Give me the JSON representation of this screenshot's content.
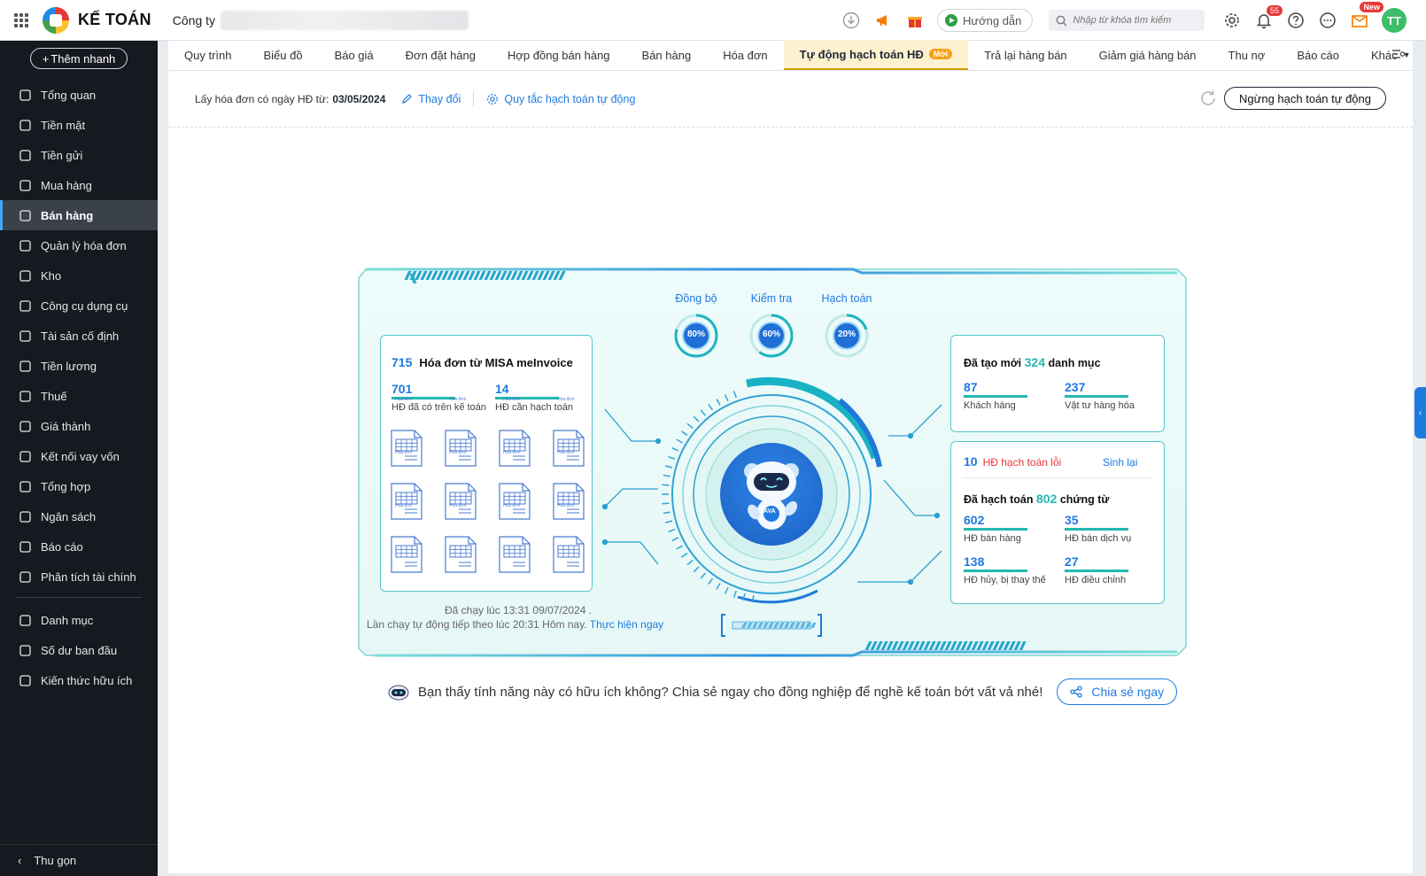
{
  "header": {
    "app_name": "KẾ TOÁN",
    "company_label": "Công ty",
    "guide_label": "Hướng dẫn",
    "search_placeholder": "Nhập từ khóa tìm kiếm",
    "notification_count": "55",
    "new_badge": "New",
    "avatar_initials": "TT"
  },
  "sidebar": {
    "quick_add": "Thêm nhanh",
    "items": [
      {
        "label": "Tổng quan",
        "icon": "chart-pie-icon"
      },
      {
        "label": "Tiền mặt",
        "icon": "money-bag-icon"
      },
      {
        "label": "Tiền gửi",
        "icon": "bank-icon"
      },
      {
        "label": "Mua hàng",
        "icon": "shopping-bag-icon"
      },
      {
        "label": "Bán hàng",
        "icon": "cart-icon",
        "active": true
      },
      {
        "label": "Quản lý hóa đơn",
        "icon": "invoice-icon"
      },
      {
        "label": "Kho",
        "icon": "warehouse-icon"
      },
      {
        "label": "Công cụ dụng cụ",
        "icon": "tools-icon"
      },
      {
        "label": "Tài sản cố định",
        "icon": "asset-icon"
      },
      {
        "label": "Tiền lương",
        "icon": "payroll-icon"
      },
      {
        "label": "Thuế",
        "icon": "tax-icon"
      },
      {
        "label": "Giá thành",
        "icon": "price-tag-icon"
      },
      {
        "label": "Kết nối vay vốn",
        "icon": "loan-icon"
      },
      {
        "label": "Tổng hợp",
        "icon": "summary-icon"
      },
      {
        "label": "Ngân sách",
        "icon": "budget-icon"
      },
      {
        "label": "Báo cáo",
        "icon": "report-icon"
      },
      {
        "label": "Phân tích tài chính",
        "icon": "analytics-icon"
      }
    ],
    "items2": [
      {
        "label": "Danh mục",
        "icon": "list-icon"
      },
      {
        "label": "Số dư ban đầu",
        "icon": "opening-balance-icon"
      },
      {
        "label": "Kiến thức hữu ích",
        "icon": "knowledge-icon"
      }
    ],
    "collapse": "Thu gọn"
  },
  "tabs": [
    "Quy trình",
    "Biểu đồ",
    "Báo giá",
    "Đơn đặt hàng",
    "Hợp đồng bán hàng",
    "Bán hàng",
    "Hóa đơn",
    "Tự động hạch toán HĐ",
    "Trả lại hàng bán",
    "Giảm giá hàng bán",
    "Thu nợ",
    "Báo cáo",
    "Khác"
  ],
  "active_tab_badge": "Mới",
  "toolbar": {
    "date_label": "Lấy hóa đơn có ngày HĐ từ:",
    "date_value": "03/05/2024",
    "change": "Thay đổi",
    "rules": "Quy tắc hạch toán tự động",
    "stop": "Ngừng hạch toán tự động"
  },
  "dashboard": {
    "stages": [
      {
        "label": "Đồng bộ",
        "percent": "80%",
        "value": 0.8
      },
      {
        "label": "Kiểm tra",
        "percent": "60%",
        "value": 0.6
      },
      {
        "label": "Hạch toán",
        "percent": "20%",
        "value": 0.2
      }
    ],
    "invoices": {
      "count": "715",
      "title": "Hóa đơn từ MISA meInvoice",
      "in_books": "701",
      "in_books_label": "HĐ đã có trên kế toán",
      "to_post": "14",
      "to_post_label": "HĐ cần hạch toán",
      "doc_label": "Hóa đơn"
    },
    "ran_at": "Đã chạy lúc 13:31 09/07/2024 .",
    "next_run": "Lần chạy tự động tiếp theo lúc 20:31 Hôm nay.",
    "run_now": "Thực hiện ngay",
    "bot_name": "AVA",
    "categories": {
      "prefix": "Đã tạo mới",
      "count": "324",
      "suffix": "danh mục",
      "customers": "87",
      "customers_label": "Khách hàng",
      "items": "237",
      "items_label": "Vật tư hàng hóa"
    },
    "errors": {
      "count": "10",
      "label": "HĐ hạch toán lỗi",
      "regen": "Sinh lại"
    },
    "posted": {
      "prefix": "Đã hạch toán",
      "count": "802",
      "suffix": "chứng từ",
      "sales": "602",
      "sales_label": "HĐ bán hàng",
      "service": "35",
      "service_label": "HĐ bán dịch vụ",
      "cancelled": "138",
      "cancelled_label": "HĐ hủy, bị thay thế",
      "adjusted": "27",
      "adjusted_label": "HĐ điều chỉnh"
    }
  },
  "share": {
    "question": "Bạn thấy tính năng này có hữu ích không? Chia sẻ ngay cho đồng nghiệp để nghề kế toán bớt vất vả nhé!",
    "button": "Chia sẻ ngay"
  },
  "colors": {
    "accent": "#1f7ae0",
    "teal": "#24b8b0",
    "sidebar": "#16191f",
    "active_tab": "#fdf1cf"
  }
}
